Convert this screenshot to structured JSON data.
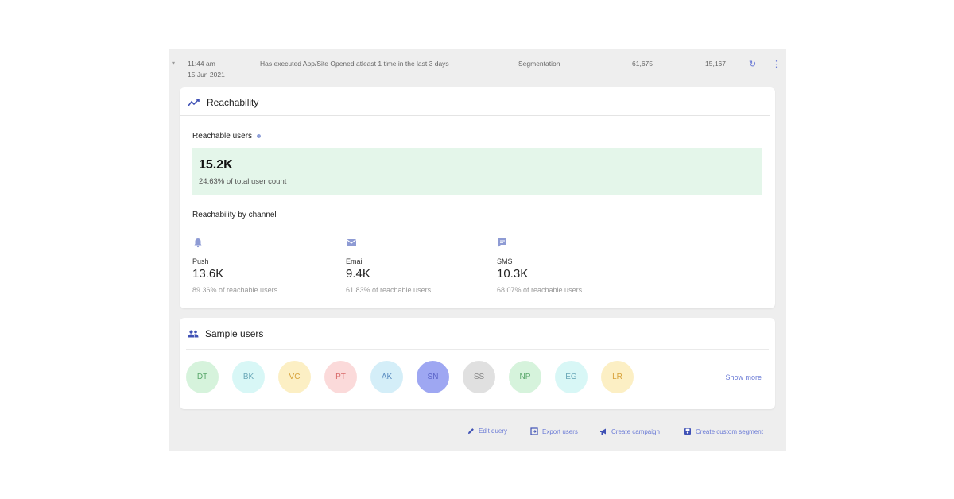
{
  "query_row": {
    "time": "11:44 am",
    "date": "15 Jun 2021",
    "description": "Has executed App/Site Opened atleast 1 time in the last 3 days",
    "type": "Segmentation",
    "total": "61,675",
    "reached": "15,167"
  },
  "reachability": {
    "title": "Reachability",
    "reachable_label": "Reachable users",
    "reachable_count": "15.2K",
    "reachable_sub": "24.63% of total user count",
    "by_channel_label": "Reachability by channel",
    "channels": [
      {
        "name": "Push",
        "value": "13.6K",
        "sub": "89.36% of reachable users",
        "icon": "bell-icon"
      },
      {
        "name": "Email",
        "value": "9.4K",
        "sub": "61.83% of reachable users",
        "icon": "mail-icon"
      },
      {
        "name": "SMS",
        "value": "10.3K",
        "sub": "68.07% of reachable users",
        "icon": "message-icon"
      }
    ]
  },
  "sample_users": {
    "title": "Sample users",
    "users": [
      {
        "initials": "DT",
        "bg": "#d6f3dc",
        "fg": "#5aa86c"
      },
      {
        "initials": "BK",
        "bg": "#d8f7f6",
        "fg": "#6aa8b8"
      },
      {
        "initials": "VC",
        "bg": "#fcefc4",
        "fg": "#d7a23a"
      },
      {
        "initials": "PT",
        "bg": "#fbdada",
        "fg": "#d86a6a"
      },
      {
        "initials": "AK",
        "bg": "#d4eef8",
        "fg": "#5a8cc0"
      },
      {
        "initials": "SN",
        "bg": "#9ea7f2",
        "fg": "#5b64c8"
      },
      {
        "initials": "SS",
        "bg": "#e0e0e0",
        "fg": "#888888"
      },
      {
        "initials": "NP",
        "bg": "#d6f3dc",
        "fg": "#5aa86c"
      },
      {
        "initials": "EG",
        "bg": "#d8f7f6",
        "fg": "#6aa8b8"
      },
      {
        "initials": "LR",
        "bg": "#fcefc4",
        "fg": "#d7a23a"
      }
    ],
    "show_more": "Show more"
  },
  "actions": {
    "edit_query": "Edit query",
    "export_users": "Export users",
    "create_campaign": "Create campaign",
    "create_segment": "Create custom segment"
  },
  "colors": {
    "accent": "#6b7bd6",
    "reach_bg": "#e4f6ea"
  }
}
